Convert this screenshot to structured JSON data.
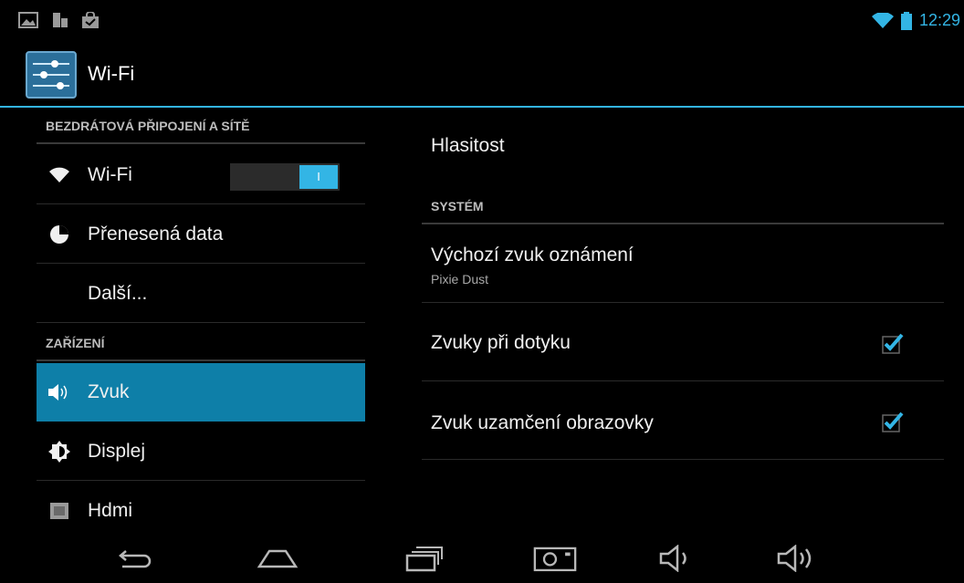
{
  "status_bar": {
    "icons": [
      "image-icon",
      "sd-card-icon",
      "shop-bag-icon"
    ],
    "clock": "12:29",
    "right_icons": [
      "wifi-icon",
      "battery-icon"
    ]
  },
  "action_bar": {
    "icon": "settings-sliders-icon",
    "title": "Wi-Fi"
  },
  "left_pane": {
    "header_wireless": "BEZDRÁTOVÁ PŘIPOJENÍ A SÍTĚ",
    "wifi_label": "Wi-Fi",
    "wifi_toggle": "I",
    "data_label": "Přenesená data",
    "more_label": "Další...",
    "header_device": "ZAŘÍZENÍ",
    "sound_label": "Zvuk",
    "display_label": "Displej",
    "hdmi_label": "Hdmi"
  },
  "right_pane": {
    "volume_label": "Hlasitost",
    "header_system": "SYSTÉM",
    "notif_sound_label": "Výchozí zvuk oznámení",
    "notif_sound_value": "Pixie Dust",
    "touch_sounds_label": "Zvuky při dotyku",
    "touch_sounds_checked": true,
    "lock_sound_label": "Zvuk uzamčení obrazovky",
    "lock_sound_checked": true
  },
  "nav_bar": {
    "buttons": [
      "back-icon",
      "home-icon",
      "recent-apps-icon",
      "screenshot-icon",
      "volume-down-icon",
      "volume-up-icon"
    ]
  },
  "colors": {
    "accent": "#33b5e5",
    "selected": "#0e7fa8",
    "background": "#000000"
  }
}
